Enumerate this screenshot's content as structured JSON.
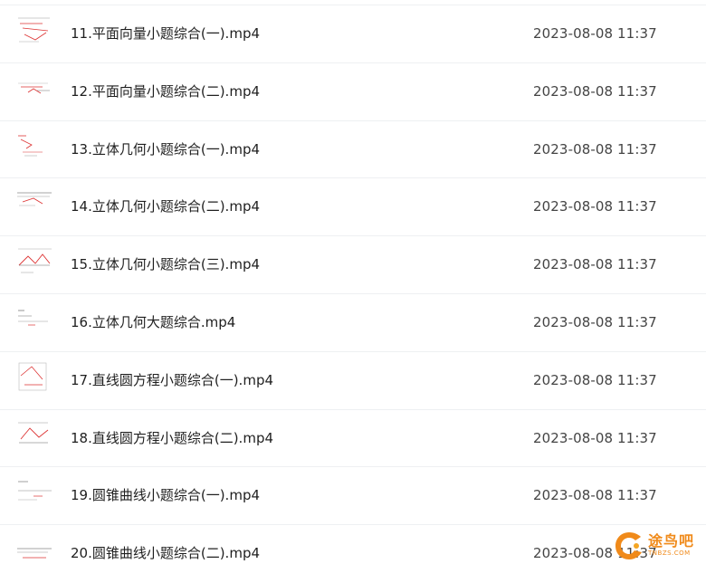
{
  "files": [
    {
      "name": "11.平面向量小题综合(一).mp4",
      "date": "2023-08-08 11:37"
    },
    {
      "name": "12.平面向量小题综合(二).mp4",
      "date": "2023-08-08 11:37"
    },
    {
      "name": "13.立体几何小题综合(一).mp4",
      "date": "2023-08-08 11:37"
    },
    {
      "name": "14.立体几何小题综合(二).mp4",
      "date": "2023-08-08 11:37"
    },
    {
      "name": "15.立体几何小题综合(三).mp4",
      "date": "2023-08-08 11:37"
    },
    {
      "name": "16.立体几何大题综合.mp4",
      "date": "2023-08-08 11:37"
    },
    {
      "name": "17.直线圆方程小题综合(一).mp4",
      "date": "2023-08-08 11:37"
    },
    {
      "name": "18.直线圆方程小题综合(二).mp4",
      "date": "2023-08-08 11:37"
    },
    {
      "name": "19.圆锥曲线小题综合(一).mp4",
      "date": "2023-08-08 11:37"
    },
    {
      "name": "20.圆锥曲线小题综合(二).mp4",
      "date": "2023-08-08 11:37"
    }
  ],
  "watermark": {
    "text_cn": "途鸟吧",
    "text_en": "TNBZS.COM",
    "color": "#f08a1a"
  },
  "icons": {
    "thumbnail": "video-thumbnail-icon"
  }
}
